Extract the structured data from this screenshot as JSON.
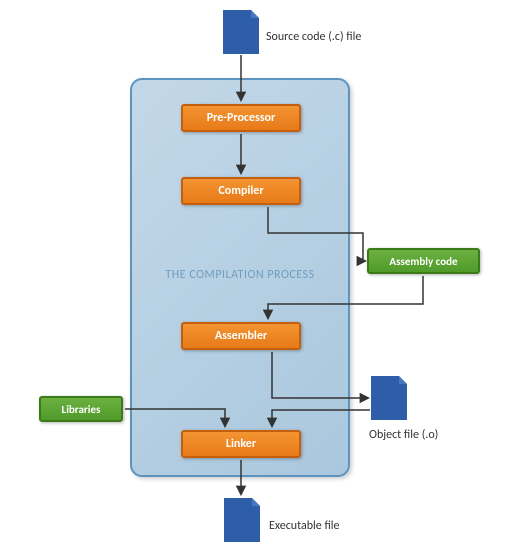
{
  "title": "THE COMPILATION PROCESS",
  "files": {
    "source": {
      "label": "Source code (.c) file"
    },
    "object": {
      "label": "Object file (.o)"
    },
    "executable": {
      "label": "Executable file"
    }
  },
  "stages": {
    "preprocessor": {
      "label": "Pre-Processor"
    },
    "compiler": {
      "label": "Compiler"
    },
    "assembler": {
      "label": "Assembler"
    },
    "linker": {
      "label": "Linker"
    }
  },
  "artifacts": {
    "assembly": {
      "label": "Assembly code"
    },
    "libraries": {
      "label": "Libraries"
    }
  },
  "chart_data": {
    "type": "flowchart",
    "nodes": [
      {
        "id": "source",
        "kind": "file",
        "label": "Source code (.c) file"
      },
      {
        "id": "preprocessor",
        "kind": "process",
        "label": "Pre-Processor"
      },
      {
        "id": "compiler",
        "kind": "process",
        "label": "Compiler"
      },
      {
        "id": "assembly",
        "kind": "data",
        "label": "Assembly code"
      },
      {
        "id": "assembler",
        "kind": "process",
        "label": "Assembler"
      },
      {
        "id": "object",
        "kind": "file",
        "label": "Object file (.o)"
      },
      {
        "id": "libraries",
        "kind": "data",
        "label": "Libraries"
      },
      {
        "id": "linker",
        "kind": "process",
        "label": "Linker"
      },
      {
        "id": "executable",
        "kind": "file",
        "label": "Executable file"
      }
    ],
    "edges": [
      {
        "from": "source",
        "to": "preprocessor"
      },
      {
        "from": "preprocessor",
        "to": "compiler"
      },
      {
        "from": "compiler",
        "to": "assembly"
      },
      {
        "from": "assembly",
        "to": "assembler"
      },
      {
        "from": "assembler",
        "to": "object"
      },
      {
        "from": "object",
        "to": "linker"
      },
      {
        "from": "libraries",
        "to": "linker"
      },
      {
        "from": "linker",
        "to": "executable"
      }
    ],
    "container": "THE COMPILATION PROCESS"
  }
}
